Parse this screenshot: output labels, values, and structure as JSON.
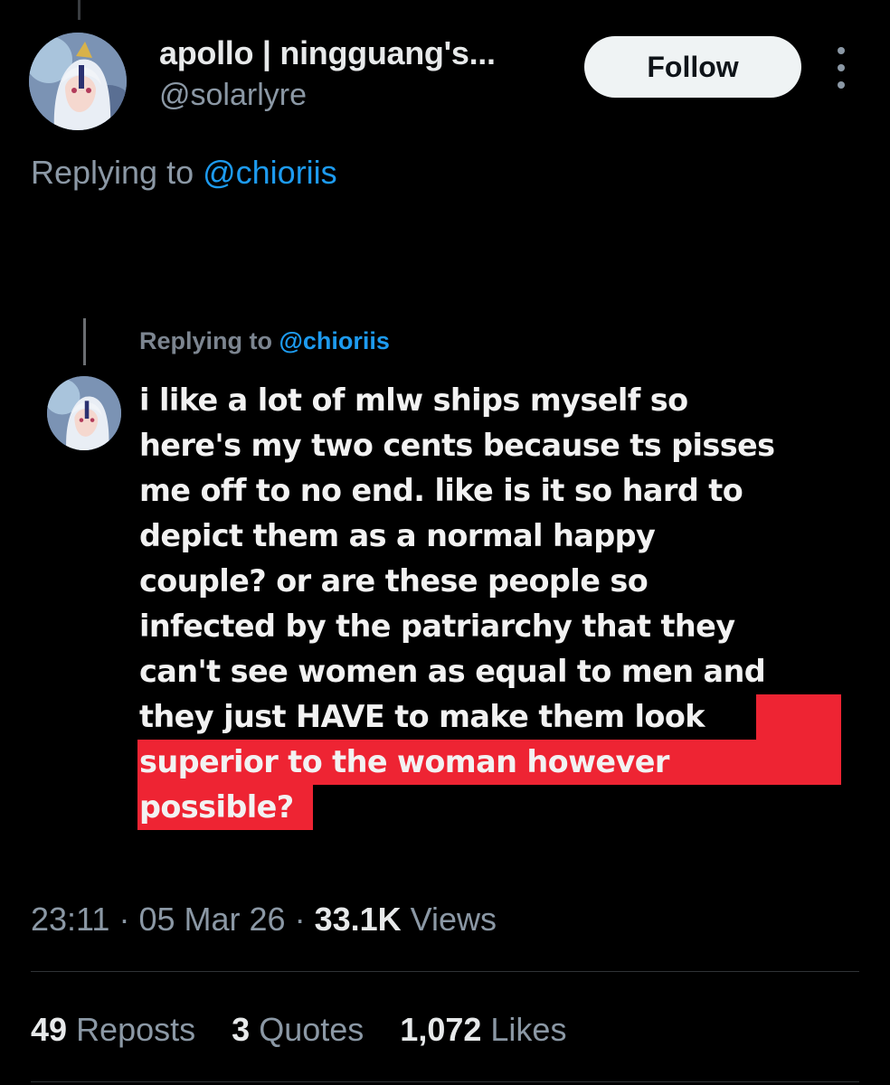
{
  "author": {
    "display_name": "apollo | ningguang's...",
    "handle": "@solarlyre"
  },
  "follow_label": "Follow",
  "reply_context": {
    "prefix": "Replying to ",
    "mention": "@chioriis"
  },
  "embedded_post": {
    "reply_prefix": "Replying to ",
    "reply_mention": "@chioriis",
    "lines": [
      "i like a lot of mlw ships myself so",
      "here's my two cents because ts pisses",
      "me off to no end. like is it so hard to",
      "depict them as a normal happy",
      "couple? or are these people so",
      "infected by the patriarchy that they",
      "can't see women as equal to men and",
      "they just HAVE to make them look"
    ],
    "highlighted_lines": [
      "superior to the woman however",
      "possible?"
    ],
    "highlight_color": "#ee2433"
  },
  "meta": {
    "time": "23:11",
    "date": "05 Mar 26",
    "views_count": "33.1K",
    "views_label": "Views",
    "separator": "·"
  },
  "stats": {
    "reposts_count": "49",
    "reposts_label": "Reposts",
    "quotes_count": "3",
    "quotes_label": "Quotes",
    "likes_count": "1,072",
    "likes_label": "Likes"
  },
  "colors": {
    "background": "#000000",
    "accent": "#1d9bf0",
    "secondary_text": "#8b98a5"
  }
}
